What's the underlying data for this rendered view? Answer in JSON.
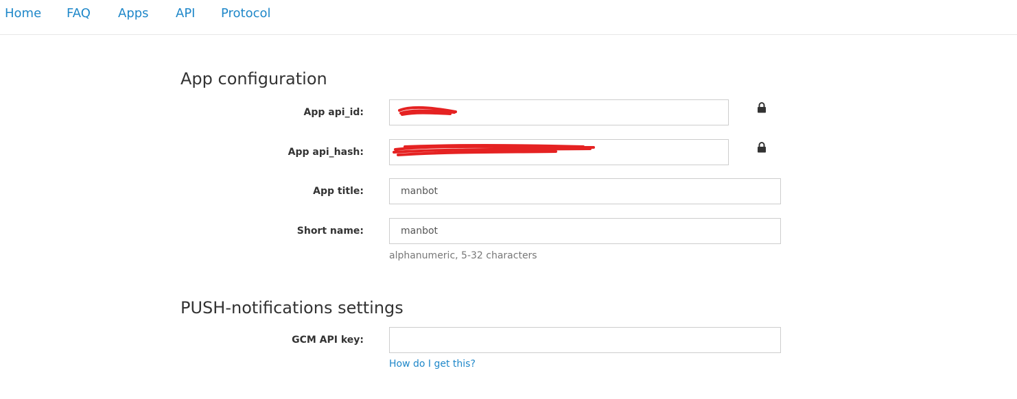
{
  "nav": {
    "items": [
      {
        "label": "Home"
      },
      {
        "label": "FAQ"
      },
      {
        "label": "Apps"
      },
      {
        "label": "API"
      },
      {
        "label": "Protocol"
      }
    ]
  },
  "app_config": {
    "title": "App configuration",
    "api_id": {
      "label": "App api_id:",
      "value": ""
    },
    "api_hash": {
      "label": "App api_hash:",
      "value": ""
    },
    "app_title": {
      "label": "App title:",
      "value": "manbot"
    },
    "short_name": {
      "label": "Short name:",
      "value": "manbot",
      "hint": "alphanumeric, 5-32 characters"
    }
  },
  "push": {
    "title": "PUSH-notifications settings",
    "gcm_key": {
      "label": "GCM API key:",
      "value": ""
    },
    "help_link": "How do I get this?"
  },
  "colors": {
    "link": "#1e87c9",
    "redaction": "#e52222"
  },
  "icons": {
    "lock": "lock-icon"
  }
}
